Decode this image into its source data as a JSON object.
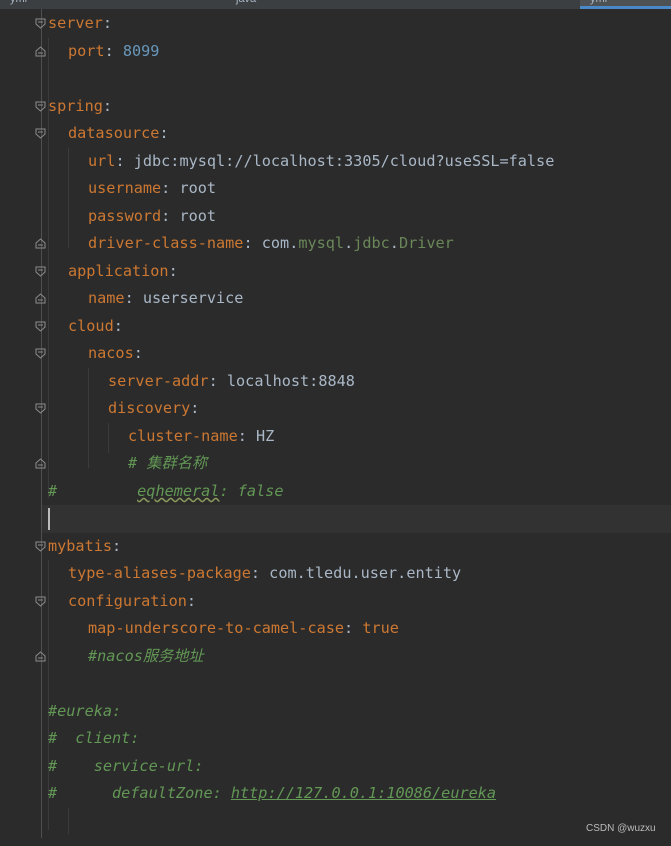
{
  "tabs": [
    {
      "label": "yml"
    },
    {
      "label": "java"
    },
    {
      "label": "yml"
    }
  ],
  "code": {
    "l1": {
      "k": "server",
      "p": ":"
    },
    "l2": {
      "k": "port",
      "p": ": ",
      "v": "8099"
    },
    "l4": {
      "k": "spring",
      "p": ":"
    },
    "l5": {
      "k": "datasource",
      "p": ":"
    },
    "l6": {
      "k": "url",
      "p": ": ",
      "v": "jdbc:mysql://localhost:3305/cloud?useSSL=false"
    },
    "l7": {
      "k": "username",
      "p": ": ",
      "v": "root"
    },
    "l8": {
      "k": "password",
      "p": ": ",
      "v": "root"
    },
    "l9": {
      "k": "driver-class-name",
      "p": ": ",
      "pkg1": "com",
      "d1": ".",
      "pkg2": "mysql",
      "d2": ".",
      "pkg3": "jdbc",
      "d3": ".",
      "cls": "Driver"
    },
    "l10": {
      "k": "application",
      "p": ":"
    },
    "l11": {
      "k": "name",
      "p": ": ",
      "v": "userservice"
    },
    "l12": {
      "k": "cloud",
      "p": ":"
    },
    "l13": {
      "k": "nacos",
      "p": ":"
    },
    "l14": {
      "k": "server-addr",
      "p": ": ",
      "v": "localhost:8848"
    },
    "l15": {
      "k": "discovery",
      "p": ":"
    },
    "l16": {
      "k": "cluster-name",
      "p": ": ",
      "v": "HZ"
    },
    "l17": {
      "c": "# 集群名称"
    },
    "l18": {
      "hash": "#",
      "k": "eqhemeral",
      "p": ": ",
      "v": "false"
    },
    "l20": {
      "k": "mybatis",
      "p": ":"
    },
    "l21": {
      "k": "type-aliases-package",
      "p": ": ",
      "v": "com.tledu.user.entity"
    },
    "l22": {
      "k": "configuration",
      "p": ":"
    },
    "l23": {
      "k": "map-underscore-to-camel-case",
      "p": ": ",
      "v": "true"
    },
    "l24": {
      "c": "#nacos服务地址"
    },
    "l26": {
      "c": "#eureka:"
    },
    "l27": {
      "c": "#  client:"
    },
    "l28": {
      "c": "#    service-url:"
    },
    "l29": {
      "c": "#      defaultZone: ",
      "url": "http://127.0.0.1:10086/eureka"
    }
  },
  "watermark": "CSDN @wuzxu",
  "colors": {
    "background": "#2b2b2b",
    "key": "#cc7832",
    "number": "#6897bb",
    "comment": "#629755",
    "text": "#a9b7c6"
  }
}
